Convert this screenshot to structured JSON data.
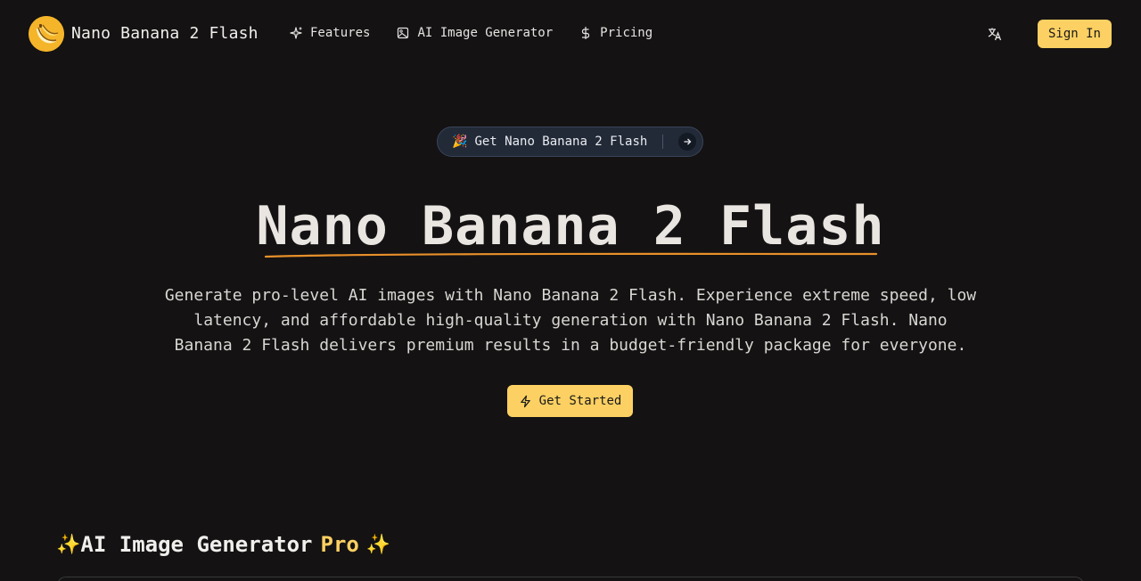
{
  "header": {
    "brand": "Nano Banana 2 Flash",
    "logo_icon": "banana-logo-icon",
    "nav": [
      {
        "label": "Features",
        "icon": "sparkles-icon"
      },
      {
        "label": "AI Image Generator",
        "icon": "image-icon"
      },
      {
        "label": "Pricing",
        "icon": "dollar-icon"
      }
    ],
    "language_icon": "translate-icon",
    "signin_label": "Sign In"
  },
  "hero": {
    "pill_emoji": "🎉",
    "pill_text": "Get Nano Banana 2 Flash",
    "title": "Nano Banana 2 Flash",
    "description": "Generate pro-level AI images with Nano Banana 2 Flash. Experience extreme speed, low latency, and affordable high-quality generation with Nano Banana 2 Flash. Nano Banana 2 Flash delivers premium results in a budget-friendly package for everyone.",
    "cta_label": "Get Started",
    "cta_icon": "zap-icon"
  },
  "section": {
    "spark_left": "✨",
    "title": "AI Image Generator",
    "title_accent": "Pro",
    "spark_right": "✨"
  },
  "colors": {
    "background": "#141213",
    "accent": "#fcd062",
    "underline": "#e8902a",
    "pill_bg": "#222a38"
  }
}
